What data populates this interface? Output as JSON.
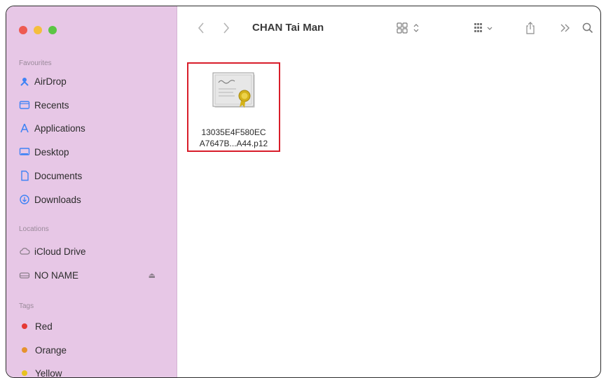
{
  "sidebar": {
    "favourites_label": "Favourites",
    "favourites": [
      {
        "label": "AirDrop",
        "icon": "airdrop-icon"
      },
      {
        "label": "Recents",
        "icon": "recents-icon"
      },
      {
        "label": "Applications",
        "icon": "applications-icon"
      },
      {
        "label": "Desktop",
        "icon": "desktop-icon"
      },
      {
        "label": "Documents",
        "icon": "documents-icon"
      },
      {
        "label": "Downloads",
        "icon": "downloads-icon"
      }
    ],
    "locations_label": "Locations",
    "locations": [
      {
        "label": "iCloud Drive",
        "icon": "cloud-icon"
      },
      {
        "label": "NO NAME",
        "icon": "drive-icon",
        "eject_icon": "eject-icon"
      }
    ],
    "tags_label": "Tags",
    "tags": [
      {
        "label": "Red",
        "color": "#e53935"
      },
      {
        "label": "Orange",
        "color": "#e6922e"
      },
      {
        "label": "Yellow",
        "color": "#e8c21f"
      }
    ]
  },
  "toolbar": {
    "title": "CHAN Tai Man",
    "icons": [
      "back-icon",
      "forward-icon",
      "grid-view-icon",
      "group-icon",
      "share-icon",
      "more-icon",
      "search-icon"
    ]
  },
  "files": [
    {
      "name_line1": "13035E4F580EC",
      "name_line2": "A7647B...A44.p12",
      "icon": "certificate-icon",
      "selected_border": "#d81d2a"
    }
  ],
  "window_controls": {
    "close": "#ee5a52",
    "minimize": "#f5be3d",
    "zoom": "#5bc544"
  }
}
